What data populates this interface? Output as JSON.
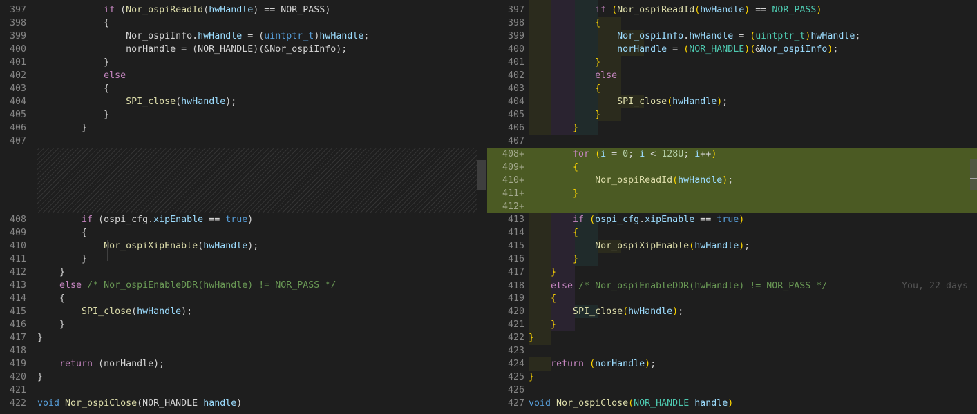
{
  "left": {
    "lines": [
      {
        "num": "397",
        "code": "            if (Nor_ospiReadId(hwHandle) == NOR_PASS)"
      },
      {
        "num": "398",
        "code": "            {"
      },
      {
        "num": "399",
        "code": "                Nor_ospiInfo.hwHandle = (uintptr_t)hwHandle;"
      },
      {
        "num": "400",
        "code": "                norHandle = (NOR_HANDLE)(&Nor_ospiInfo);"
      },
      {
        "num": "401",
        "code": "            }"
      },
      {
        "num": "402",
        "code": "            else"
      },
      {
        "num": "403",
        "code": "            {"
      },
      {
        "num": "404",
        "code": "                SPI_close(hwHandle);"
      },
      {
        "num": "405",
        "code": "            }"
      },
      {
        "num": "406",
        "code": "        }"
      },
      {
        "num": "407",
        "code": ""
      },
      {
        "num": "408",
        "code": "        if (ospi_cfg.xipEnable == true)"
      },
      {
        "num": "409",
        "code": "        {"
      },
      {
        "num": "410",
        "code": "            Nor_ospiXipEnable(hwHandle);"
      },
      {
        "num": "411",
        "code": "        }"
      },
      {
        "num": "412",
        "code": "    }"
      },
      {
        "num": "413",
        "code": "    else /* Nor_ospiEnableDDR(hwHandle) != NOR_PASS */"
      },
      {
        "num": "414",
        "code": "    {"
      },
      {
        "num": "415",
        "code": "        SPI_close(hwHandle);"
      },
      {
        "num": "416",
        "code": "    }"
      },
      {
        "num": "417",
        "code": "}"
      },
      {
        "num": "418",
        "code": ""
      },
      {
        "num": "419",
        "code": "    return (norHandle);"
      },
      {
        "num": "420",
        "code": "}"
      },
      {
        "num": "421",
        "code": ""
      },
      {
        "num": "422",
        "code": "void Nor_ospiClose(NOR_HANDLE handle)"
      }
    ]
  },
  "right": {
    "lines": [
      {
        "num": "397",
        "code": "            if (Nor_ospiReadId(hwHandle) == NOR_PASS)"
      },
      {
        "num": "398",
        "code": "            {"
      },
      {
        "num": "399",
        "code": "                Nor_ospiInfo.hwHandle = (uintptr_t)hwHandle;"
      },
      {
        "num": "400",
        "code": "                norHandle = (NOR_HANDLE)(&Nor_ospiInfo);"
      },
      {
        "num": "401",
        "code": "            }"
      },
      {
        "num": "402",
        "code": "            else"
      },
      {
        "num": "403",
        "code": "            {"
      },
      {
        "num": "404",
        "code": "                SPI_close(hwHandle);"
      },
      {
        "num": "405",
        "code": "            }"
      },
      {
        "num": "406",
        "code": "        }"
      },
      {
        "num": "407",
        "code": ""
      },
      {
        "num": "408+",
        "code": "        for (i = 0; i < 128U; i++)"
      },
      {
        "num": "409+",
        "code": "        {"
      },
      {
        "num": "410+",
        "code": "            Nor_ospiReadId(hwHandle);"
      },
      {
        "num": "411+",
        "code": "        }"
      },
      {
        "num": "412+",
        "code": ""
      },
      {
        "num": "413",
        "code": "        if (ospi_cfg.xipEnable == true)"
      },
      {
        "num": "414",
        "code": "        {"
      },
      {
        "num": "415",
        "code": "            Nor_ospiXipEnable(hwHandle);"
      },
      {
        "num": "416",
        "code": "        }"
      },
      {
        "num": "417",
        "code": "    }"
      },
      {
        "num": "418",
        "code": "    else /* Nor_ospiEnableDDR(hwHandle) != NOR_PASS */"
      },
      {
        "num": "419",
        "code": "    {"
      },
      {
        "num": "420",
        "code": "        SPI_close(hwHandle);"
      },
      {
        "num": "421",
        "code": "    }"
      },
      {
        "num": "422",
        "code": "}"
      },
      {
        "num": "423",
        "code": ""
      },
      {
        "num": "424",
        "code": "    return (norHandle);"
      },
      {
        "num": "425",
        "code": "}"
      },
      {
        "num": "426",
        "code": ""
      },
      {
        "num": "427",
        "code": "void Nor_ospiClose(NOR_HANDLE handle)"
      }
    ],
    "blame": "You, 22 days"
  },
  "colors": {
    "added_bg": "#4b5a23",
    "editor_bg": "#1e1e1e",
    "keyword": "#c586c0",
    "function": "#dcdcaa",
    "variable": "#9cdcfe",
    "type": "#4ec9b0",
    "comment": "#6a9955"
  }
}
